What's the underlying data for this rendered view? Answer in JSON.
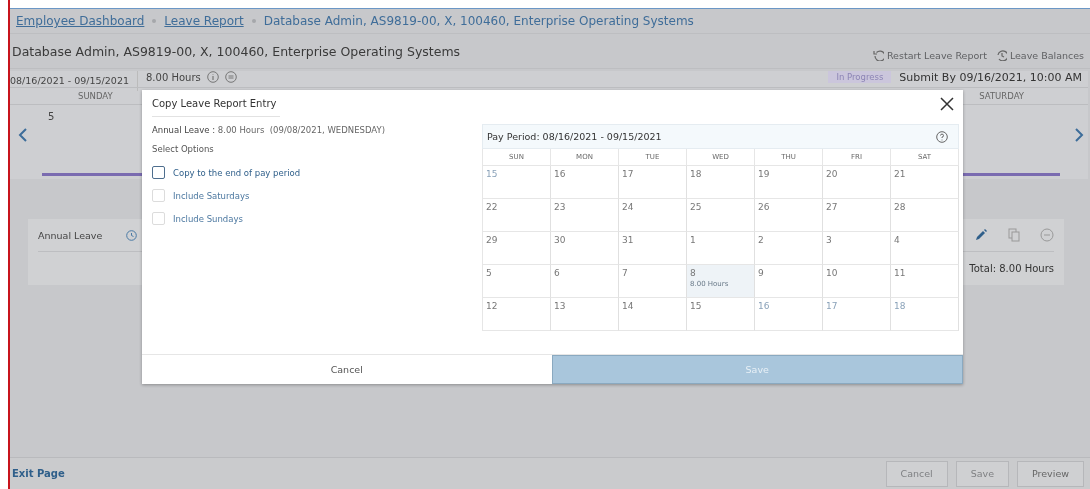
{
  "breadcrumb": [
    {
      "label": "Employee Dashboard",
      "link": true
    },
    {
      "label": "Leave Report",
      "link": true
    },
    {
      "label": "Database Admin, AS9819-00, X, 100460, Enterprise Operating Systems",
      "link": false
    }
  ],
  "header": {
    "title": "Database Admin, AS9819-00, X, 100460, Enterprise Operating Systems",
    "actions": [
      {
        "label": "Restart Leave Report",
        "kind": "restart"
      },
      {
        "label": "Leave Balances",
        "kind": "balances"
      }
    ]
  },
  "report": {
    "period": "08/16/2021 - 09/15/2021",
    "hours": "8.00 Hours",
    "status": "In Progress",
    "submit_by": "Submit By 09/16/2021, 10:00 AM",
    "day_headers": [
      {
        "label": "SUNDAY"
      },
      {
        "label": "SATURDAY"
      }
    ],
    "visible_day": "5"
  },
  "entry": {
    "type": "Annual Leave",
    "total": "Total: 8.00 Hours"
  },
  "footer": {
    "exit": "Exit Page",
    "buttons": [
      {
        "label": "Cancel",
        "disabled": true
      },
      {
        "label": "Save",
        "disabled": true
      },
      {
        "label": "Preview",
        "disabled": false
      }
    ]
  },
  "dialog": {
    "title": "Copy Leave Report Entry",
    "summary": "**Annual Leave :** 8.00 Hours  (09/08/2021, WEDNESDAY)",
    "options_label": "Select Options",
    "options": [
      {
        "label": "Copy to the end of pay period",
        "checked": false,
        "disabled": false
      },
      {
        "label": "Include Saturdays",
        "checked": false,
        "disabled": true
      },
      {
        "label": "Include Sundays",
        "checked": false,
        "disabled": true
      }
    ],
    "calendar": {
      "title": "Pay Period: 08/16/2021 - 09/15/2021",
      "weekdays": [
        "SUN",
        "MON",
        "TUE",
        "WED",
        "THU",
        "FRI",
        "SAT"
      ],
      "weeks": [
        [
          {
            "day": "15",
            "in_period": false,
            "selected": false
          },
          {
            "day": "16",
            "in_period": true,
            "selected": false
          },
          {
            "day": "17",
            "in_period": true,
            "selected": false
          },
          {
            "day": "18",
            "in_period": true,
            "selected": false
          },
          {
            "day": "19",
            "in_period": true,
            "selected": false
          },
          {
            "day": "20",
            "in_period": true,
            "selected": false
          },
          {
            "day": "21",
            "in_period": true,
            "selected": false
          }
        ],
        [
          {
            "day": "22",
            "in_period": true,
            "selected": false
          },
          {
            "day": "23",
            "in_period": true,
            "selected": false
          },
          {
            "day": "24",
            "in_period": true,
            "selected": false
          },
          {
            "day": "25",
            "in_period": true,
            "selected": false
          },
          {
            "day": "26",
            "in_period": true,
            "selected": false
          },
          {
            "day": "27",
            "in_period": true,
            "selected": false
          },
          {
            "day": "28",
            "in_period": true,
            "selected": false
          }
        ],
        [
          {
            "day": "29",
            "in_period": true,
            "selected": false
          },
          {
            "day": "30",
            "in_period": true,
            "selected": false
          },
          {
            "day": "31",
            "in_period": true,
            "selected": false
          },
          {
            "day": "1",
            "in_period": true,
            "selected": false
          },
          {
            "day": "2",
            "in_period": true,
            "selected": false
          },
          {
            "day": "3",
            "in_period": true,
            "selected": false
          },
          {
            "day": "4",
            "in_period": true,
            "selected": false
          }
        ],
        [
          {
            "day": "5",
            "in_period": true,
            "selected": false
          },
          {
            "day": "6",
            "in_period": true,
            "selected": false
          },
          {
            "day": "7",
            "in_period": true,
            "selected": false
          },
          {
            "day": "8",
            "in_period": true,
            "selected": true,
            "note": "8.00 Hours"
          },
          {
            "day": "9",
            "in_period": true,
            "selected": false
          },
          {
            "day": "10",
            "in_period": true,
            "selected": false
          },
          {
            "day": "11",
            "in_period": true,
            "selected": false
          }
        ],
        [
          {
            "day": "12",
            "in_period": true,
            "selected": false
          },
          {
            "day": "13",
            "in_period": true,
            "selected": false
          },
          {
            "day": "14",
            "in_period": true,
            "selected": false
          },
          {
            "day": "15",
            "in_period": true,
            "selected": false
          },
          {
            "day": "16",
            "in_period": false,
            "selected": false
          },
          {
            "day": "17",
            "in_period": false,
            "selected": false
          },
          {
            "day": "18",
            "in_period": false,
            "selected": false
          }
        ]
      ]
    },
    "buttons": [
      {
        "label": "Cancel",
        "kind": "cancel",
        "disabled": false
      },
      {
        "label": "Save",
        "kind": "save",
        "disabled": true
      }
    ]
  }
}
